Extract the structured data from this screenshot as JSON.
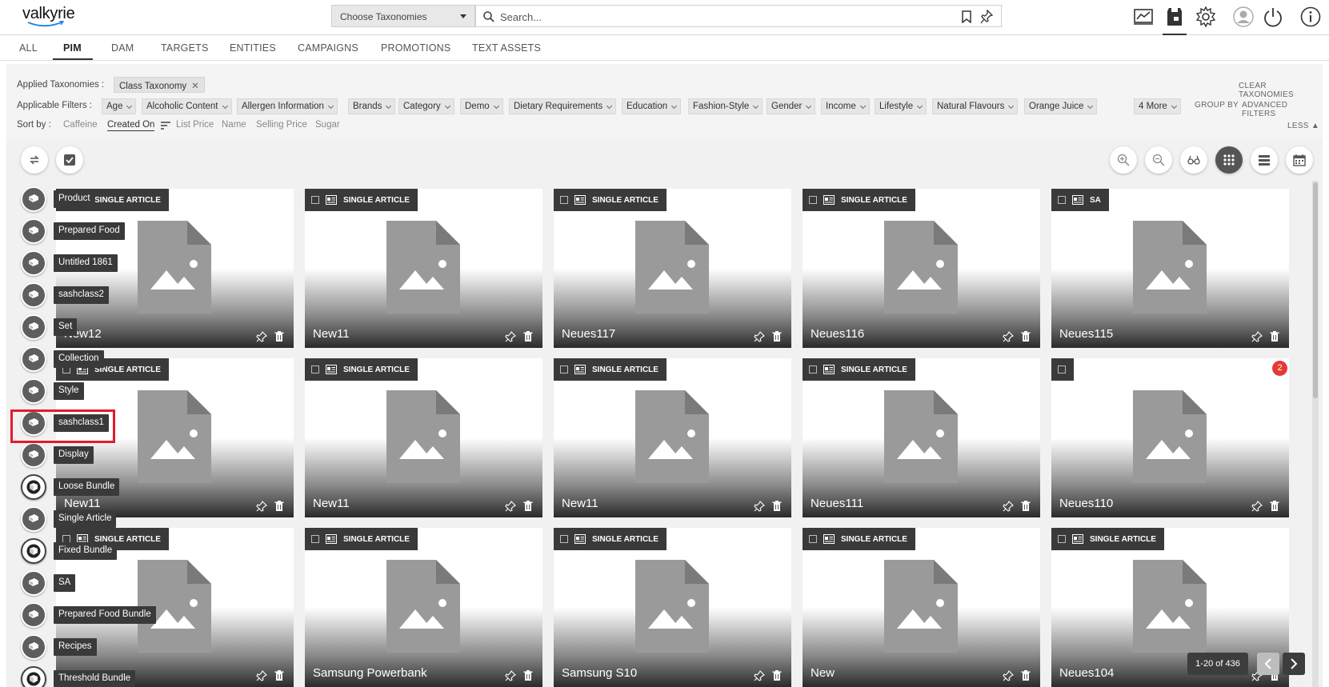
{
  "header": {
    "logo": "valkyrie",
    "taxonomy_select": "Choose Taxonomies",
    "search_placeholder": "Search..."
  },
  "tabs": [
    {
      "label": "ALL"
    },
    {
      "label": "PIM",
      "active": true
    },
    {
      "label": "DAM"
    },
    {
      "label": "TARGETS"
    },
    {
      "label": "ENTITIES"
    },
    {
      "label": "CAMPAIGNS"
    },
    {
      "label": "PROMOTIONS"
    },
    {
      "label": "TEXT ASSETS"
    }
  ],
  "filters": {
    "applied_label": "Applied Taxonomies :",
    "applied_chip": "Class Taxonomy",
    "clear_label": "CLEAR TAXONOMIES",
    "applicable_label": "Applicable Filters :",
    "items": [
      "Age",
      "Alcoholic Content",
      "Allergen Information",
      "Brands",
      "Category",
      "Demo",
      "Dietary Requirements",
      "Education",
      "Fashion-Style",
      "Gender",
      "Income",
      "Lifestyle",
      "Natural Flavours",
      "Orange Juice"
    ],
    "more_label": "4 More",
    "group_by": "GROUP BY",
    "advanced": "ADVANCED FILTERS",
    "sort_label": "Sort by :",
    "sort_options": [
      "Caffeine",
      "Created On",
      "List Price",
      "Name",
      "Selling Price",
      "Sugar"
    ],
    "sort_active": "Created On",
    "less_label": "LESS"
  },
  "classes": [
    {
      "label": "Product",
      "icon": "book-icon"
    },
    {
      "label": "Prepared Food",
      "icon": "book-icon"
    },
    {
      "label": "Untitled 1861",
      "icon": "book-icon"
    },
    {
      "label": "sashclass2",
      "icon": "book-icon"
    },
    {
      "label": "Set",
      "icon": "book-icon"
    },
    {
      "label": "Collection",
      "icon": "book-icon"
    },
    {
      "label": "Style",
      "icon": "book-icon"
    },
    {
      "label": "sashclass1",
      "icon": "book-icon",
      "highlighted": true
    },
    {
      "label": "Display",
      "icon": "book-icon"
    },
    {
      "label": "Loose Bundle",
      "icon": "bundle-icon"
    },
    {
      "label": "Single Article",
      "icon": "book-icon"
    },
    {
      "label": "Fixed Bundle",
      "icon": "bundle-icon"
    },
    {
      "label": "SA",
      "icon": "book-icon"
    },
    {
      "label": "Prepared Food Bundle",
      "icon": "book-icon"
    },
    {
      "label": "Recipes",
      "icon": "book-icon"
    },
    {
      "label": "Threshold Bundle",
      "icon": "bundle-icon"
    }
  ],
  "cards": [
    {
      "type": "SINGLE ARTICLE",
      "title": "New12"
    },
    {
      "type": "SINGLE ARTICLE",
      "title": "New11"
    },
    {
      "type": "SINGLE ARTICLE",
      "title": "Neues117"
    },
    {
      "type": "SINGLE ARTICLE",
      "title": "Neues116"
    },
    {
      "type": "SA",
      "title": "Neues115"
    },
    {
      "type": "SINGLE ARTICLE",
      "title": "New11"
    },
    {
      "type": "SINGLE ARTICLE",
      "title": "New11"
    },
    {
      "type": "SINGLE ARTICLE",
      "title": "New11"
    },
    {
      "type": "SINGLE ARTICLE",
      "title": "Neues111"
    },
    {
      "type": "",
      "title": "Neues110",
      "notification": "2"
    },
    {
      "type": "SINGLE ARTICLE",
      "title": ""
    },
    {
      "type": "SINGLE ARTICLE",
      "title": "Samsung Powerbank"
    },
    {
      "type": "SINGLE ARTICLE",
      "title": "Samsung S10"
    },
    {
      "type": "SINGLE ARTICLE",
      "title": "New"
    },
    {
      "type": "SINGLE ARTICLE",
      "title": "Neues104"
    }
  ],
  "pagination": {
    "label": "1-20 of 436"
  }
}
